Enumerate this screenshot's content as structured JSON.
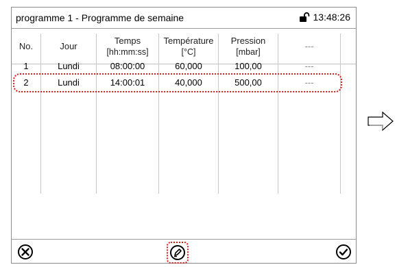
{
  "header": {
    "title": "programme 1 - Programme de semaine",
    "time": "13:48:26",
    "lock_icon": "lock-open-icon"
  },
  "table": {
    "columns": [
      {
        "line1": "No.",
        "line2": ""
      },
      {
        "line1": "Jour",
        "line2": ""
      },
      {
        "line1": "Temps",
        "line2": "[hh:mm:ss]"
      },
      {
        "line1": "Température",
        "line2": "[°C]"
      },
      {
        "line1": "Pression",
        "line2": "[mbar]"
      },
      {
        "line1": "---",
        "line2": ""
      }
    ],
    "rows": [
      {
        "no": "1",
        "jour": "Lundi",
        "temps": "08:00:00",
        "temperature": "60,000",
        "pression": "100,00",
        "extra": "---"
      },
      {
        "no": "2",
        "jour": "Lundi",
        "temps": "14:00:01",
        "temperature": "40,000",
        "pression": "500,00",
        "extra": "---"
      }
    ],
    "selected_row": 1
  },
  "footer": {
    "cancel_icon": "cancel-icon",
    "edit_icon": "edit-pencil-icon",
    "confirm_icon": "check-icon"
  },
  "annotations": {
    "highlight_color": "#e11818",
    "next_arrow_icon": "right-arrow-icon"
  }
}
